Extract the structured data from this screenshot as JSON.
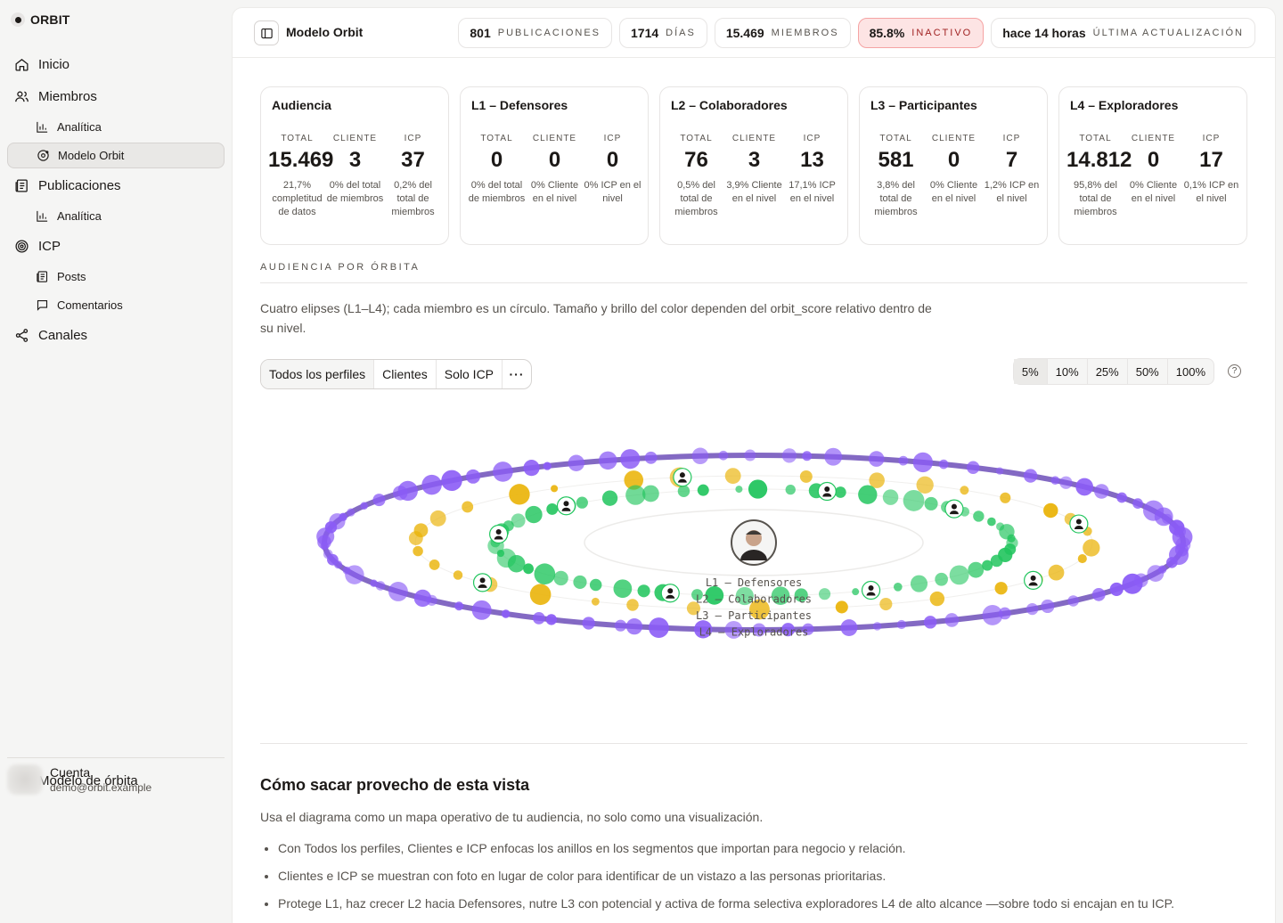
{
  "brand": "ORBIT",
  "nav": {
    "inicio": "Inicio",
    "miembros": "Miembros",
    "miembros_analitica": "Analítica",
    "modelo_orbit": "Modelo Orbit",
    "publicaciones": "Publicaciones",
    "publicaciones_analitica": "Analítica",
    "icp": "ICP",
    "posts": "Posts",
    "comentarios": "Comentarios",
    "canales": "Canales",
    "modelo_orbita": "Modelo de órbita"
  },
  "account": {
    "name": "Cuenta",
    "email": "demo@orbit.example"
  },
  "header": {
    "title": "Modelo Orbit",
    "stats": [
      {
        "value": "801",
        "label": "PUBLICACIONES",
        "warn": false
      },
      {
        "value": "1714",
        "label": "DÍAS",
        "warn": false
      },
      {
        "value": "15.469",
        "label": "MIEMBROS",
        "warn": false
      },
      {
        "value": "85.8%",
        "label": "INACTIVO",
        "warn": true
      },
      {
        "value": "hace 14 horas",
        "label": "ÚLTIMA ACTUALIZACIÓN",
        "warn": false
      }
    ]
  },
  "cards": [
    {
      "title": "Audiencia",
      "cols": [
        {
          "label": "TOTAL",
          "value": "15.469",
          "sub": "21,7% completitud de datos"
        },
        {
          "label": "CLIENTE",
          "value": "3",
          "sub": "0% del total de miembros"
        },
        {
          "label": "ICP",
          "value": "37",
          "sub": "0,2% del total de miembros"
        }
      ]
    },
    {
      "title": "L1 – Defensores",
      "cols": [
        {
          "label": "TOTAL",
          "value": "0",
          "sub": "0% del total de miembros"
        },
        {
          "label": "CLIENTE",
          "value": "0",
          "sub": "0% Cliente en el nivel"
        },
        {
          "label": "ICP",
          "value": "0",
          "sub": "0% ICP en el nivel"
        }
      ]
    },
    {
      "title": "L2 – Colaboradores",
      "cols": [
        {
          "label": "TOTAL",
          "value": "76",
          "sub": "0,5% del total de miembros"
        },
        {
          "label": "CLIENTE",
          "value": "3",
          "sub": "3,9% Cliente en el nivel"
        },
        {
          "label": "ICP",
          "value": "13",
          "sub": "17,1% ICP en el nivel"
        }
      ]
    },
    {
      "title": "L3 – Participantes",
      "cols": [
        {
          "label": "TOTAL",
          "value": "581",
          "sub": "3,8% del total de miembros"
        },
        {
          "label": "CLIENTE",
          "value": "0",
          "sub": "0% Cliente en el nivel"
        },
        {
          "label": "ICP",
          "value": "7",
          "sub": "1,2% ICP en el nivel"
        }
      ]
    },
    {
      "title": "L4 – Exploradores",
      "cols": [
        {
          "label": "TOTAL",
          "value": "14.812",
          "sub": "95,8% del total de miembros"
        },
        {
          "label": "CLIENTE",
          "value": "0",
          "sub": "0% Cliente en el nivel"
        },
        {
          "label": "ICP",
          "value": "17",
          "sub": "0,1% ICP en el nivel"
        }
      ]
    }
  ],
  "orbit": {
    "section_label": "AUDIENCIA POR ÓRBITA",
    "description": "Cuatro elipses (L1–L4); cada miembro es un círculo. Tamaño y brillo del color dependen del orbit_score relativo dentro de su nivel.",
    "filters": [
      "Todos los perfiles",
      "Clientes",
      "Solo ICP"
    ],
    "more": "···",
    "percentages": [
      "5%",
      "10%",
      "25%",
      "50%",
      "100%"
    ],
    "help": "?",
    "ring_labels": [
      "L1 – Defensores",
      "L2 – Colaboradores",
      "L3 – Participantes",
      "L4 – Exploradores"
    ],
    "colors": {
      "l2": "#22c55e",
      "l3": "#eab308",
      "l4": "#8b5cf6",
      "l4_line": "#6d4fb8"
    }
  },
  "howto": {
    "title": "Cómo sacar provecho de esta vista",
    "intro": "Usa el diagrama como un mapa operativo de tu audiencia, no solo como una visualización.",
    "items": [
      "Con Todos los perfiles, Clientes e ICP enfocas los anillos en los segmentos que importan para negocio y relación.",
      "Clientes e ICP se muestran con foto en lugar de color para identificar de un vistazo a las personas prioritarias.",
      "Protege L1, haz crecer L2 hacia Defensores, nutre L3 con potencial y activa de forma selectiva exploradores L4 de alto alcance —sobre todo si encajan en tu ICP."
    ]
  }
}
